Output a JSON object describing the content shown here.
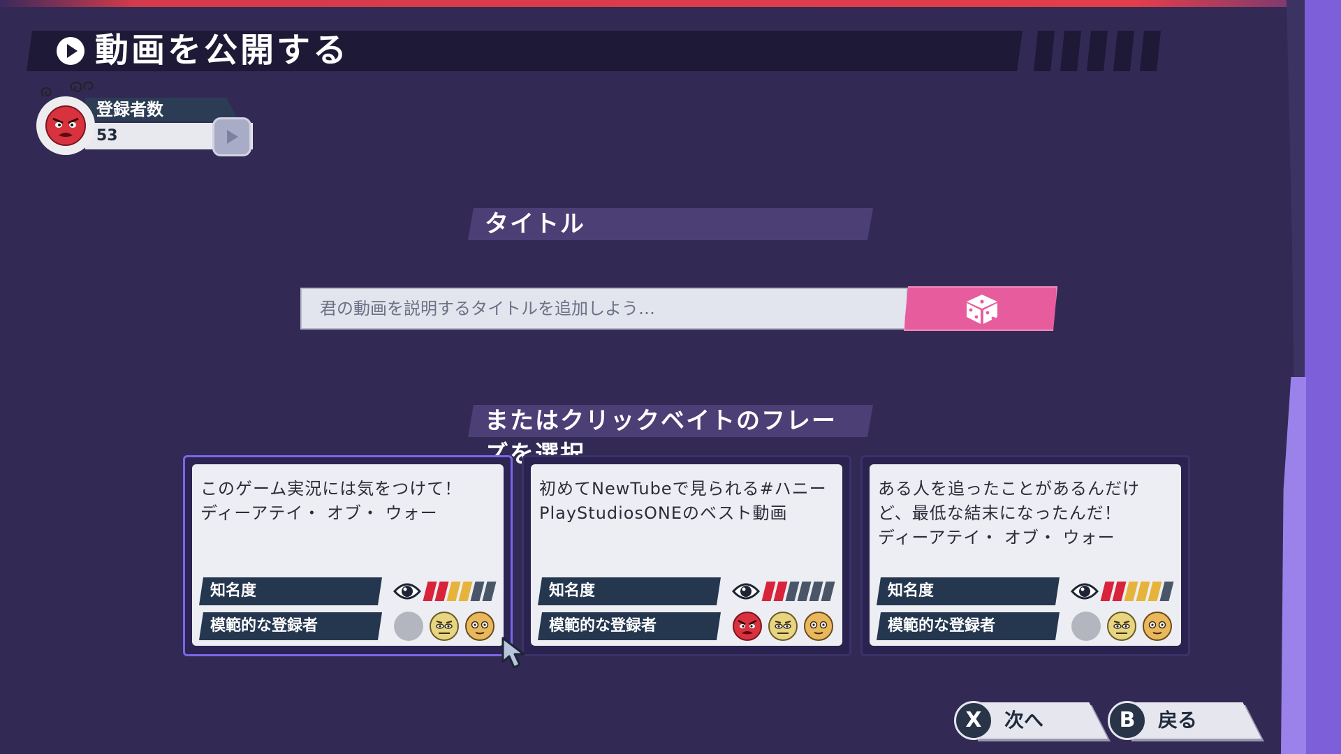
{
  "header": {
    "title": "動画を公開する"
  },
  "subscribers": {
    "label": "登録者数",
    "value": "53"
  },
  "title_section": {
    "label": "タイトル",
    "input_placeholder": "君の動画を説明するタイトルを追加しよう…",
    "input_value": ""
  },
  "clickbait_section": {
    "label": "またはクリックベイトのフレー",
    "label_overflow": "ズを選択"
  },
  "stats_labels": {
    "fame": "知名度",
    "model_subscribers": "模範的な登録者"
  },
  "cards": [
    {
      "lines": [
        "このゲーム実況には気をつけて！",
        "ディーアテイ・ オブ・ ウォー"
      ],
      "fame_meter": [
        "red",
        "red",
        "yellow",
        "yellow",
        "slate",
        "slate"
      ],
      "faces": [
        "gray",
        "neutral-yellow",
        "calm-orange"
      ],
      "selected": true
    },
    {
      "lines": [
        "初めてNewTubeで見られる#ハニー",
        "PlayStudiosONEのベスト動画"
      ],
      "fame_meter": [
        "red",
        "red",
        "slate",
        "slate",
        "slate",
        "slate"
      ],
      "faces": [
        "angry-red",
        "neutral-yellow",
        "calm-orange"
      ],
      "selected": false
    },
    {
      "lines": [
        "ある人を追ったことがあるんだけ",
        "ど、最低な結末になったんだ！",
        "ディーアテイ・ オブ・ ウォー"
      ],
      "fame_meter": [
        "red",
        "red",
        "yellow",
        "yellow",
        "yellow",
        "slate"
      ],
      "faces": [
        "gray",
        "neutral-yellow",
        "calm-orange"
      ],
      "selected": false
    }
  ],
  "footer": {
    "next": {
      "key": "X",
      "label": "次へ"
    },
    "back": {
      "key": "B",
      "label": "戻る"
    }
  },
  "colors": {
    "background": "#322a55",
    "accent_pink": "#e65c9c",
    "meter_red": "#d8233a",
    "meter_yellow": "#e6b43a",
    "meter_slate": "#4a5668"
  }
}
